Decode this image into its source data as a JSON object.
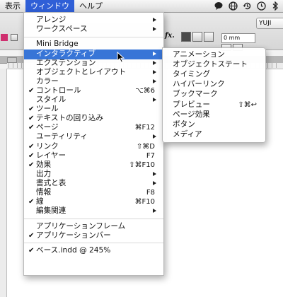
{
  "menubar": {
    "items": [
      {
        "label": "表示",
        "active": false
      },
      {
        "label": "ウィンドウ",
        "active": true
      },
      {
        "label": "ヘルプ",
        "active": false
      }
    ],
    "tray_icons": [
      "bubble-icon",
      "globe-icon",
      "time-machine-icon",
      "clock-icon",
      "bluetooth-icon"
    ]
  },
  "control_panel": {
    "user_dropdown": "YUJI",
    "fx_label": "fx.",
    "dimension_value": "0 mm"
  },
  "window_menu": {
    "items": [
      {
        "type": "item",
        "label": "アレンジ",
        "submenu": true
      },
      {
        "type": "item",
        "label": "ワークスペース",
        "submenu": true
      },
      {
        "type": "separator"
      },
      {
        "type": "item",
        "label": "Mini Bridge"
      },
      {
        "type": "item",
        "label": "インタラクティブ",
        "submenu": true,
        "highlighted": true
      },
      {
        "type": "item",
        "label": "エクステンション",
        "submenu": true
      },
      {
        "type": "item",
        "label": "オブジェクトとレイアウト",
        "submenu": true
      },
      {
        "type": "item",
        "label": "カラー",
        "submenu": true
      },
      {
        "type": "item",
        "label": "コントロール",
        "checked": true,
        "shortcut": "⌥⌘6"
      },
      {
        "type": "item",
        "label": "スタイル",
        "submenu": true
      },
      {
        "type": "item",
        "label": "ツール",
        "checked": true
      },
      {
        "type": "item",
        "label": "テキストの回り込み",
        "checked": true
      },
      {
        "type": "item",
        "label": "ページ",
        "checked": true,
        "shortcut": "⌘F12"
      },
      {
        "type": "item",
        "label": "ユーティリティ",
        "submenu": true
      },
      {
        "type": "item",
        "label": "リンク",
        "checked": true,
        "shortcut": "⇧⌘D"
      },
      {
        "type": "item",
        "label": "レイヤー",
        "checked": true,
        "shortcut": "F7"
      },
      {
        "type": "item",
        "label": "効果",
        "checked": true,
        "shortcut": "⇧⌘F10"
      },
      {
        "type": "item",
        "label": "出力",
        "submenu": true
      },
      {
        "type": "item",
        "label": "書式と表",
        "submenu": true
      },
      {
        "type": "item",
        "label": "情報",
        "shortcut": "F8"
      },
      {
        "type": "item",
        "label": "線",
        "checked": true,
        "shortcut": "⌘F10"
      },
      {
        "type": "item",
        "label": "編集関連",
        "submenu": true
      },
      {
        "type": "separator"
      },
      {
        "type": "item",
        "label": "アプリケーションフレーム"
      },
      {
        "type": "item",
        "label": "アプリケーションバー",
        "checked": true
      },
      {
        "type": "separator"
      },
      {
        "type": "item",
        "label": "ベース.indd @ 245%",
        "checked": true
      }
    ]
  },
  "interactive_submenu": {
    "items": [
      {
        "label": "アニメーション"
      },
      {
        "label": "オブジェクトステート"
      },
      {
        "label": "タイミング"
      },
      {
        "label": "ハイパーリンク"
      },
      {
        "label": "ブックマーク"
      },
      {
        "label": "プレビュー",
        "shortcut": "⇧⌘↩"
      },
      {
        "label": "ページ効果"
      },
      {
        "label": "ボタン"
      },
      {
        "label": "メディア"
      }
    ]
  },
  "colors": {
    "highlight": "#3875d7",
    "menubar_active": "#2f5fd7",
    "accent_chip": "#cf2f6f"
  }
}
